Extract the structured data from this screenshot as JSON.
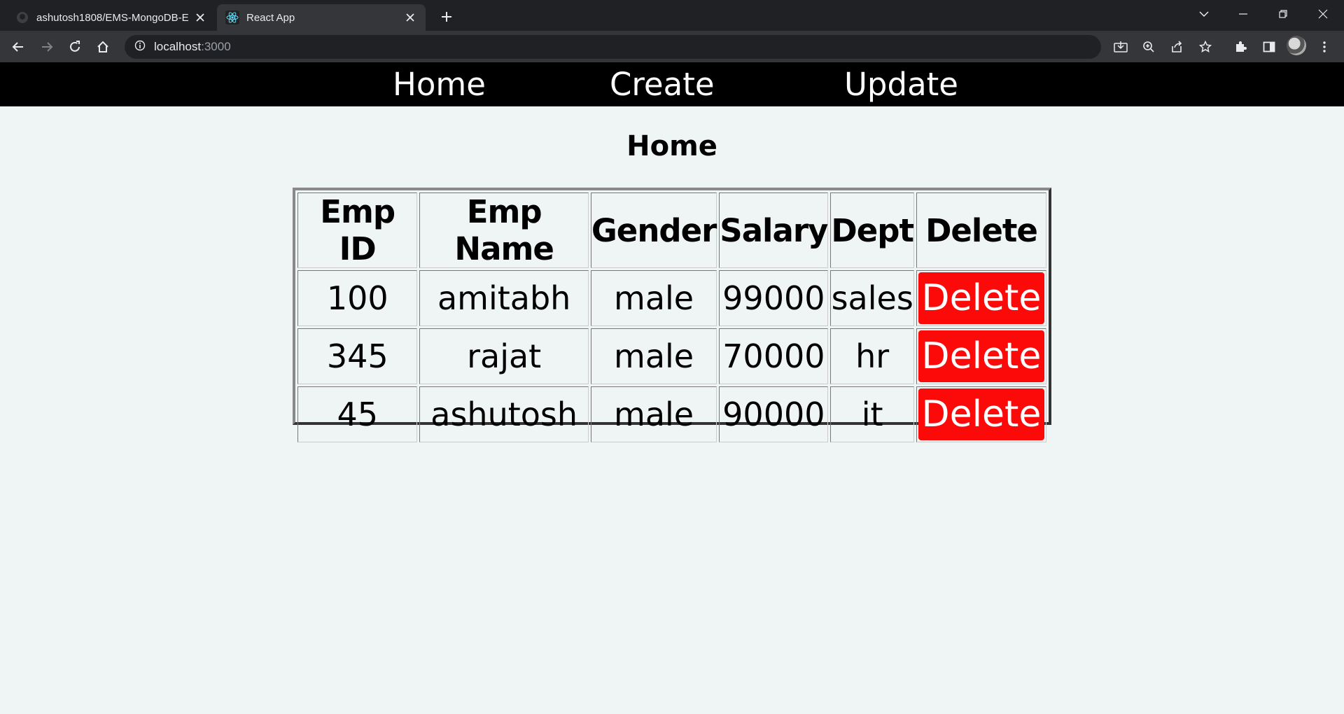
{
  "browser": {
    "tabs": [
      {
        "title": "ashutosh1808/EMS-MongoDB-E",
        "active": false,
        "icon": "github-icon"
      },
      {
        "title": "React App",
        "active": true,
        "icon": "react-icon"
      }
    ],
    "url_host": "localhost",
    "url_port": ":3000"
  },
  "nav": {
    "home": "Home",
    "create": "Create",
    "update": "Update"
  },
  "page": {
    "title": "Home"
  },
  "table": {
    "headers": [
      "Emp ID",
      "Emp Name",
      "Gender",
      "Salary",
      "Dept",
      "Delete"
    ],
    "rows": [
      {
        "id": "100",
        "name": "amitabh",
        "gender": "male",
        "salary": "99000",
        "dept": "sales",
        "action": "Delete"
      },
      {
        "id": "345",
        "name": "rajat",
        "gender": "male",
        "salary": "70000",
        "dept": "hr",
        "action": "Delete"
      },
      {
        "id": "45",
        "name": "ashutosh",
        "gender": "male",
        "salary": "90000",
        "dept": "it",
        "action": "Delete"
      }
    ]
  },
  "colors": {
    "delete_button": "#fc0a0a",
    "nav_background": "#000000",
    "page_background": "#eff4f4"
  }
}
